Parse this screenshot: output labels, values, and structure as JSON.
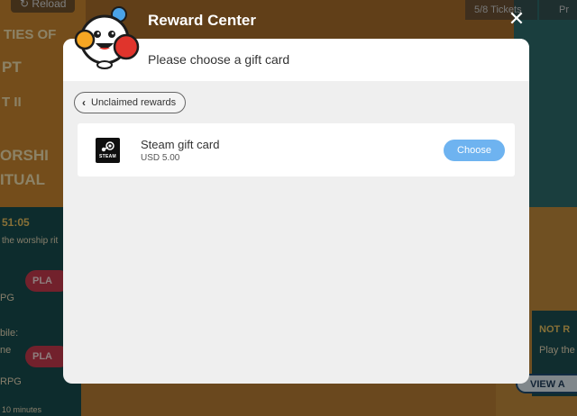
{
  "background": {
    "reload_label": "Reload",
    "tickets_label": "5/8 Tickets",
    "profile_label": "Pr",
    "left_lines": [
      "TIES OF",
      "PT",
      "T II",
      "ORSHI",
      "ITUAL",
      "51:05",
      "the worship rit",
      "PG",
      "bile:",
      "ne",
      "RPG",
      "10 minutes"
    ],
    "play_label": "PLA",
    "right_text_1": "NOT R",
    "right_text_2": "Play the",
    "view_label": "VIEW A"
  },
  "modal": {
    "title": "Reward Center",
    "subtitle": "Please choose a gift card",
    "back_label": "Unclaimed rewards",
    "reward": {
      "name": "Steam gift card",
      "price": "USD 5.00",
      "logo_text": "STEAM",
      "choose_label": "Choose"
    }
  },
  "colors": {
    "accent_blue": "#6eb3f0",
    "mascot_red": "#e0342c",
    "mascot_orange": "#f5a623",
    "mascot_blue": "#4aa3e8"
  }
}
